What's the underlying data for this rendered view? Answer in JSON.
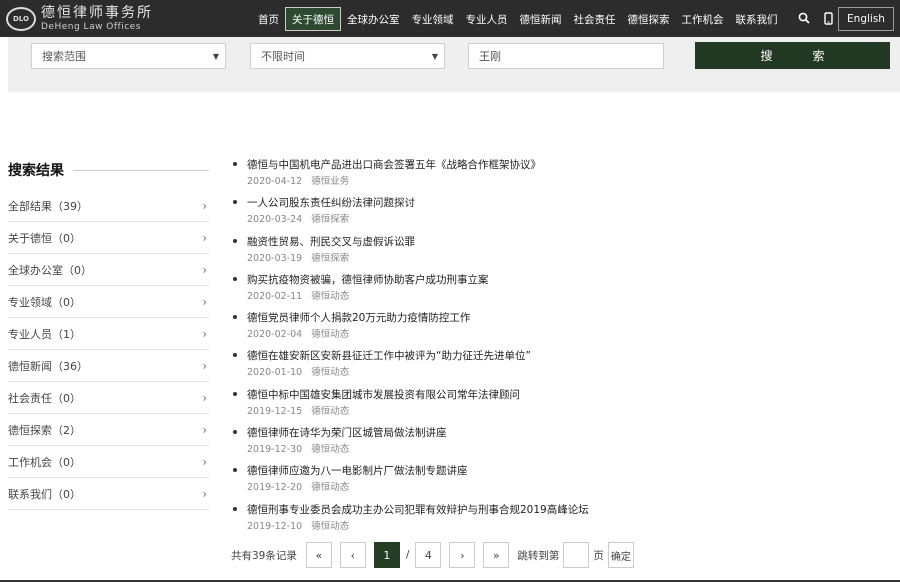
{
  "header": {
    "logo_mark": "DLO",
    "logo_cn": "德恒律师事务所",
    "logo_en": "DeHeng Law Offices",
    "nav": [
      "首页",
      "关于德恒",
      "全球办公室",
      "专业领域",
      "专业人员",
      "德恒新闻",
      "社会责任",
      "德恒探索",
      "工作机会",
      "联系我们"
    ],
    "active_nav": "关于德恒",
    "search_icon": "search-icon",
    "mobile_icon": "mobile-phone-icon",
    "language": "English"
  },
  "search": {
    "scope_value": "搜索范围",
    "time_value": "不限时间",
    "keyword_value": "王刚",
    "button_label": "搜索"
  },
  "sidebar": {
    "title": "搜索结果",
    "items": [
      {
        "label": "全部结果（39）"
      },
      {
        "label": "关于德恒（0）"
      },
      {
        "label": "全球办公室（0）"
      },
      {
        "label": "专业领域（0）"
      },
      {
        "label": "专业人员（1）"
      },
      {
        "label": "德恒新闻（36）"
      },
      {
        "label": "社会责任（0）"
      },
      {
        "label": "德恒探索（2）"
      },
      {
        "label": "工作机会（0）"
      },
      {
        "label": "联系我们（0）"
      }
    ]
  },
  "results": [
    {
      "title": "德恒与中国机电产品进出口商会签署五年《战略合作框架协议》",
      "date": "2020-04-12",
      "category": "德恒业务"
    },
    {
      "title": "一人公司股东责任纠纷法律问题探讨",
      "date": "2020-03-24",
      "category": "德恒探索"
    },
    {
      "title": "融资性贸易、刑民交叉与虚假诉讼罪",
      "date": "2020-03-19",
      "category": "德恒探索"
    },
    {
      "title": "购买抗疫物资被骗，德恒律师协助客户成功刑事立案",
      "date": "2020-02-11",
      "category": "德恒动态"
    },
    {
      "title": "德恒党员律师个人捐款20万元助力疫情防控工作",
      "date": "2020-02-04",
      "category": "德恒动态"
    },
    {
      "title": "德恒在雄安新区安新县征迁工作中被评为“助力征迁先进单位”",
      "date": "2020-01-10",
      "category": "德恒动态"
    },
    {
      "title": "德恒中标中国雄安集团城市发展投资有限公司常年法律顾问",
      "date": "2019-12-15",
      "category": "德恒动态"
    },
    {
      "title": "德恒律师在诗华为荣门区城管局做法制讲座",
      "date": "2019-12-30",
      "category": "德恒动态"
    },
    {
      "title": "德恒律师应邀为八一电影制片厂做法制专题讲座",
      "date": "2019-12-20",
      "category": "德恒动态"
    },
    {
      "title": "德恒刑事专业委员会成功主办公司犯罪有效辩护与刑事合规2019高峰论坛",
      "date": "2019-12-10",
      "category": "德恒动态"
    }
  ],
  "pagination": {
    "total_text": "共有39条记录",
    "first": "«",
    "prev": "‹",
    "current": "1",
    "separator": "/",
    "total_pages": "4",
    "next": "›",
    "last": "»",
    "jump_label": "跳转到第",
    "page_unit": "页",
    "confirm": "确定"
  },
  "colors": {
    "accent": "#243d25",
    "topbar": "#2c2c2c",
    "searchbar": "#efefef"
  }
}
